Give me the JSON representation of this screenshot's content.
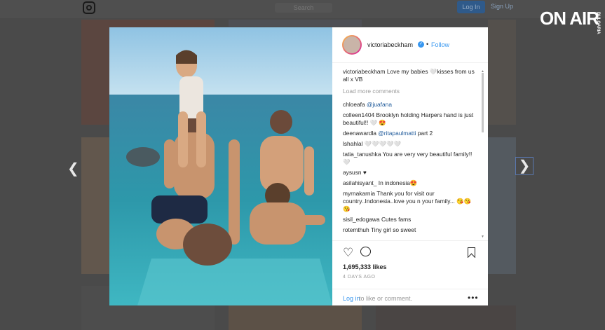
{
  "background": {
    "search_placeholder": "Search",
    "login_label": "Log In",
    "signup_label": "Sign Up"
  },
  "watermark": {
    "logo_main": "ON AIR",
    "logo_sub": "BULGARIA"
  },
  "post": {
    "username": "victoriabeckham",
    "follow_label": "Follow",
    "caption_user": "victoriabeckham",
    "caption_text": "Love my babies 🤍kisses from us all x VB",
    "load_more": "Load more comments",
    "comments": [
      {
        "user": "chloeafa",
        "mention": "@juafana",
        "text": ""
      },
      {
        "user": "colleen1404",
        "mention": "",
        "text": "Brooklyn holding Harpers hand is just beautiful!! 🤍 😍"
      },
      {
        "user": "deenawardla",
        "mention": "@ritapaulmatti",
        "text": "part 2"
      },
      {
        "user": "lshahlal",
        "mention": "",
        "text": "🤍🤍🤍🤍🤍"
      },
      {
        "user": "tatia_tanushka",
        "mention": "",
        "text": "You are very very beautiful family!! 🤍"
      },
      {
        "user": "aysusn",
        "mention": "",
        "text": "♥"
      },
      {
        "user": "asilahisyant_",
        "mention": "",
        "text": "In indonesia😍"
      },
      {
        "user": "myrnakarnia",
        "mention": "",
        "text": "Thank you for visit our country..Indonesia..love you n your family... 😘😘😘"
      },
      {
        "user": "sisil_edogawa",
        "mention": "",
        "text": "Cutes fams"
      },
      {
        "user": "rotemthuh",
        "mention": "",
        "text": "Tiny girl so sweet"
      }
    ],
    "likes": "1,695,333 likes",
    "time": "4 DAYS AGO",
    "login_link": "Log in",
    "login_text": "to like or comment.",
    "more_icon": "•••"
  }
}
